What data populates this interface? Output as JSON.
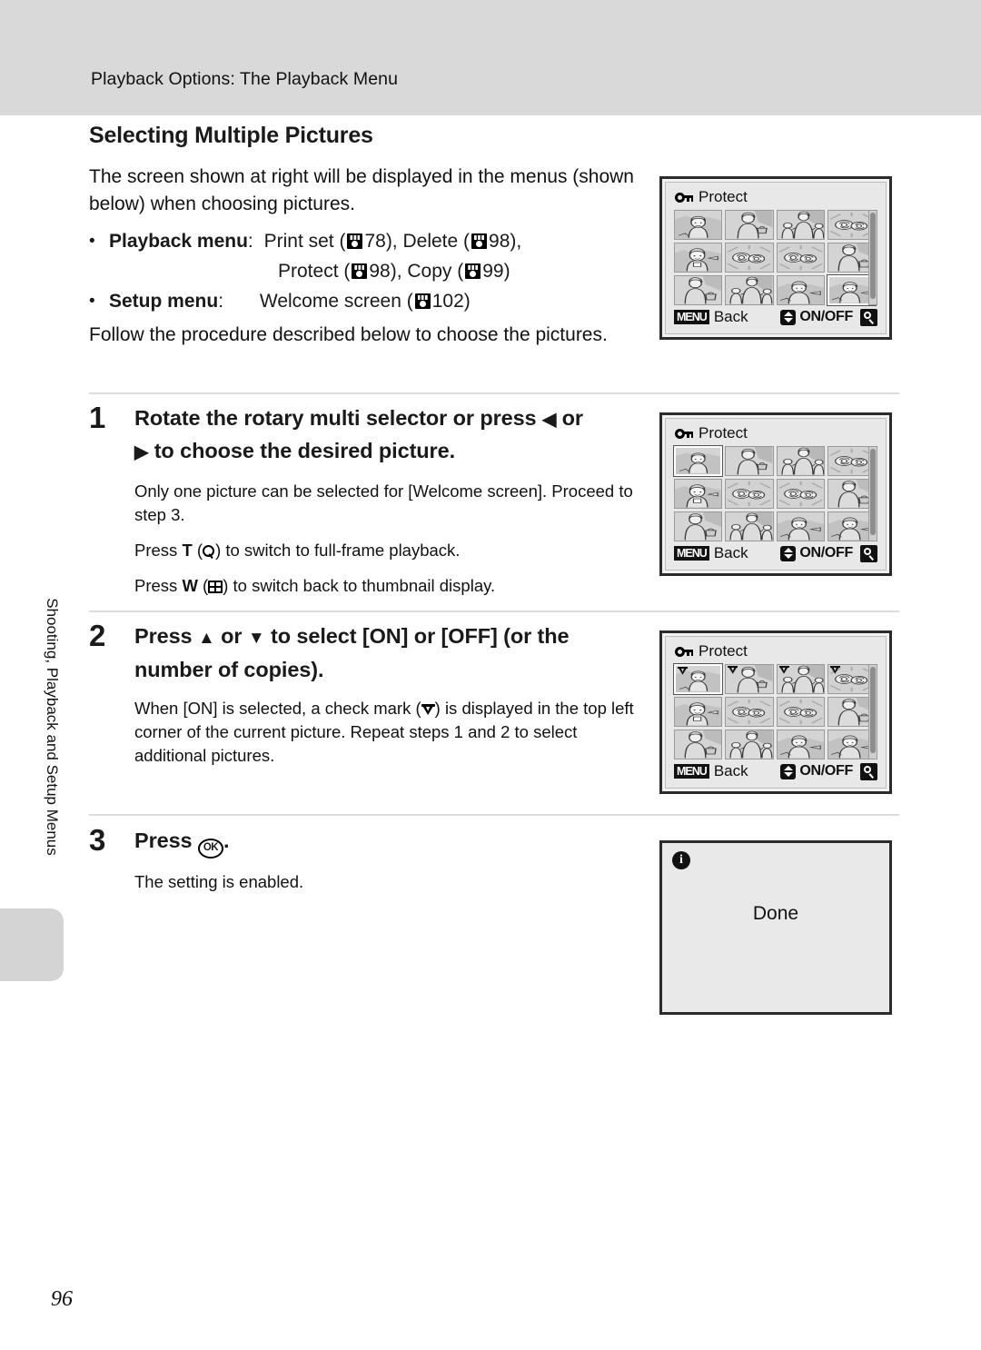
{
  "header": {
    "running_title": "Playback Options: The Playback Menu"
  },
  "side_tab": {
    "chapter_label": "Shooting, Playback and Setup Menus"
  },
  "page": {
    "number": "96"
  },
  "section": {
    "title": "Selecting Multiple Pictures",
    "intro": "The screen shown at right will be displayed in the menus (shown below) when choosing pictures.",
    "bullets": [
      {
        "label": "Playback menu",
        "colon": ":",
        "value_line1_a": "Print set (",
        "ref1": "78",
        "value_line1_b": "), Delete (",
        "ref2": "98",
        "value_line1_c": "),",
        "value_line2_a": "Protect (",
        "ref3": "98",
        "value_line2_b": "), Copy (",
        "ref4": "99",
        "value_line2_c": ")"
      },
      {
        "label": "Setup menu",
        "colon": ":",
        "value_a": "Welcome screen (",
        "ref1": "102",
        "value_b": ")"
      }
    ],
    "outro": "Follow the procedure described below to choose the pictures."
  },
  "steps": [
    {
      "num": "1",
      "title_a": "Rotate the rotary multi selector or press ",
      "title_b": " or",
      "title_c": " to choose the desired picture.",
      "paragraphs": [
        "Only one picture can be selected for [Welcome screen]. Proceed to step 3.",
        "Press T (",
        ") to switch to full-frame playback.",
        "Press W (",
        ") to switch back to thumbnail display."
      ],
      "p1": "Only one picture can be selected for [Welcome screen]. Proceed to step 3.",
      "p2_a": "Press ",
      "p2_key": "T",
      "p2_b": " (",
      "p2_c": ") to switch to full-frame playback.",
      "p3_a": "Press ",
      "p3_key": "W",
      "p3_b": " (",
      "p3_c": ") to switch back to thumbnail display."
    },
    {
      "num": "2",
      "title_a": "Press ",
      "title_b": " or ",
      "title_c": " to select [ON] or [OFF] (or the number of copies).",
      "p1_a": "When [ON] is selected, a check mark (",
      "p1_b": ") is displayed in the top left corner of the current picture. Repeat steps 1 and 2 to select additional pictures."
    },
    {
      "num": "3",
      "title_a": "Press ",
      "title_key": "OK",
      "title_b": ".",
      "p1": "The setting is enabled."
    }
  ],
  "screens": [
    {
      "name": "protect-screen-initial",
      "title": "Protect",
      "lock_icon": "key-lock-icon",
      "back_badge": "MENU",
      "back_label": "Back",
      "onoff_label": "ON/OFF",
      "magnify_icon": "magnifier-icon",
      "updown_icon": "up-down-arrow-icon",
      "selected_index": 11,
      "checked": []
    },
    {
      "name": "protect-screen-step1",
      "title": "Protect",
      "lock_icon": "key-lock-icon",
      "back_badge": "MENU",
      "back_label": "Back",
      "onoff_label": "ON/OFF",
      "magnify_icon": "magnifier-icon",
      "updown_icon": "up-down-arrow-icon",
      "selected_index": 0,
      "checked": []
    },
    {
      "name": "protect-screen-step2",
      "title": "Protect",
      "lock_icon": "key-lock-icon",
      "back_badge": "MENU",
      "back_label": "Back",
      "onoff_label": "ON/OFF",
      "magnify_icon": "magnifier-icon",
      "updown_icon": "up-down-arrow-icon",
      "selected_index": 0,
      "checked": [
        0,
        1,
        2,
        3
      ]
    }
  ],
  "done_screen": {
    "name": "done-confirmation-screen",
    "info_icon": "info-icon",
    "info_glyph": "i",
    "label": "Done"
  }
}
